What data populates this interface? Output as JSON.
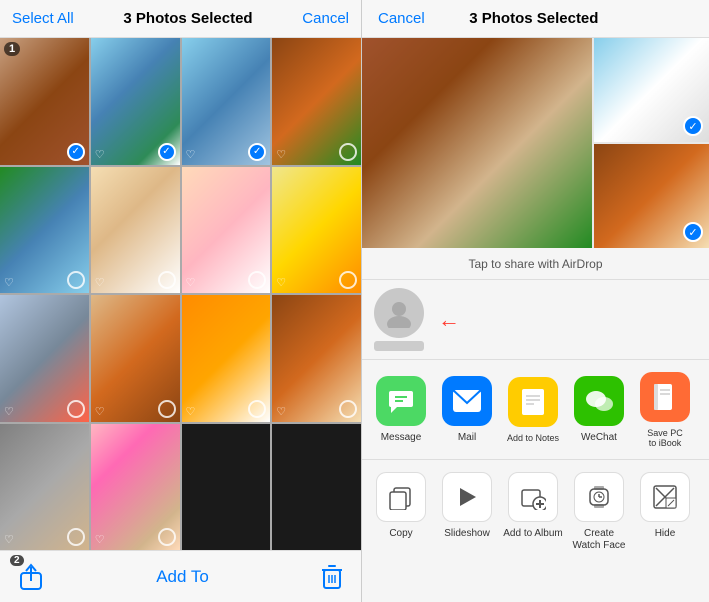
{
  "left": {
    "header": {
      "select_all": "Select All",
      "selected_count": "3 Photos Selected",
      "cancel": "Cancel"
    },
    "toolbar": {
      "badge": "2",
      "add_to": "Add To"
    },
    "photos": [
      {
        "id": 1,
        "color": "c1",
        "selected": true,
        "badge": "1"
      },
      {
        "id": 2,
        "color": "c2",
        "selected": true
      },
      {
        "id": 3,
        "color": "c3",
        "selected": true
      },
      {
        "id": 4,
        "color": "c4",
        "selected": false
      },
      {
        "id": 5,
        "color": "c5",
        "selected": false
      },
      {
        "id": 6,
        "color": "c6",
        "selected": false
      },
      {
        "id": 7,
        "color": "c7",
        "selected": false
      },
      {
        "id": 8,
        "color": "c8",
        "selected": false
      },
      {
        "id": 9,
        "color": "c9",
        "selected": false
      },
      {
        "id": 10,
        "color": "c10",
        "selected": false
      },
      {
        "id": 11,
        "color": "c11",
        "selected": false
      },
      {
        "id": 12,
        "color": "c12",
        "selected": false
      },
      {
        "id": 13,
        "color": "c13",
        "selected": false
      },
      {
        "id": 14,
        "color": "c14",
        "selected": false
      }
    ]
  },
  "right": {
    "header": {
      "cancel": "Cancel",
      "selected_count": "3 Photos Selected"
    },
    "airdrop_hint": "Tap to share with AirDrop",
    "contact": {
      "name_masked": true
    },
    "actions": [
      {
        "id": "message",
        "label": "Message",
        "color": "green",
        "icon": "💬"
      },
      {
        "id": "mail",
        "label": "Mail",
        "color": "blue",
        "icon": "✉️"
      },
      {
        "id": "notes",
        "label": "Add to Notes",
        "color": "yellow",
        "icon": "📝"
      },
      {
        "id": "wechat",
        "label": "WeChat",
        "color": "wechat-green",
        "icon": "💬"
      },
      {
        "id": "ibook",
        "label": "Save PC to iBook",
        "color": "orange",
        "icon": "📖"
      }
    ],
    "more_actions": [
      {
        "id": "copy",
        "label": "Copy",
        "icon": "copy"
      },
      {
        "id": "slideshow",
        "label": "Slideshow",
        "icon": "play"
      },
      {
        "id": "add-album",
        "label": "Add to Album",
        "icon": "add-album"
      },
      {
        "id": "watch-face",
        "label": "Create Watch Face",
        "icon": "watch"
      },
      {
        "id": "hide",
        "label": "Hide",
        "icon": "hide"
      }
    ]
  }
}
